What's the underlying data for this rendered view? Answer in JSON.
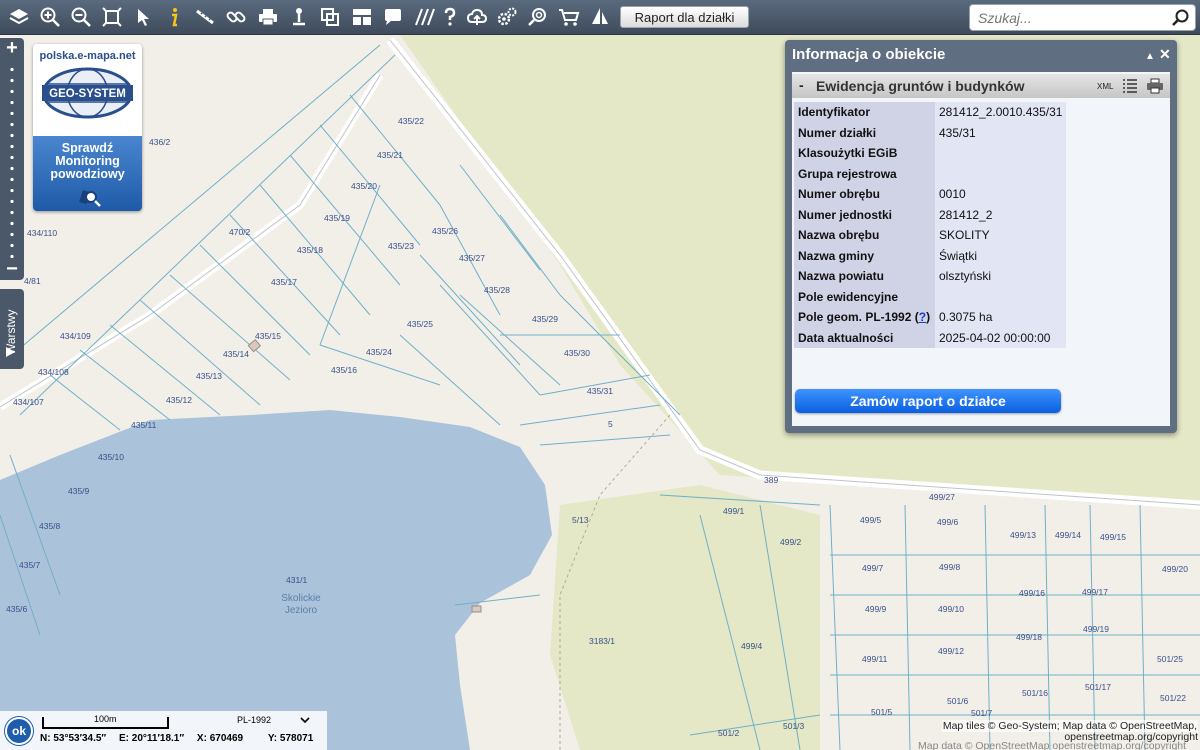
{
  "toolbar": {
    "tools": [
      {
        "name": "layers-icon"
      },
      {
        "name": "zoom-in-icon"
      },
      {
        "name": "zoom-out-icon"
      },
      {
        "name": "full-extent-icon"
      },
      {
        "name": "pointer-icon"
      },
      {
        "name": "info-icon"
      },
      {
        "name": "measure-icon"
      },
      {
        "name": "link-icon"
      },
      {
        "name": "print-icon"
      },
      {
        "name": "marker-icon"
      },
      {
        "name": "copy-icon"
      },
      {
        "name": "layout-icon"
      },
      {
        "name": "comment-icon"
      },
      {
        "name": "hatch-icon"
      },
      {
        "name": "help-icon"
      },
      {
        "name": "cloud-upload-icon"
      },
      {
        "name": "settings-icon"
      },
      {
        "name": "search-zoom-icon"
      },
      {
        "name": "cart-icon"
      },
      {
        "name": "sail-icon"
      }
    ],
    "report_button": "Raport dla działki",
    "search_placeholder": "Szukaj..."
  },
  "zoom": {
    "plus": "+",
    "minus": "−"
  },
  "layers_tab": "Warstwy",
  "banner": {
    "url": "polska.e-mapa.net",
    "logo": "GEO-SYSTEM",
    "line1": "Sprawdź",
    "line2": "Monitoring",
    "line3": "powodziowy"
  },
  "info_panel": {
    "title": "Informacja o obiekcie",
    "collapse": "▲",
    "close": "✕",
    "section_toggle": "-",
    "section_title": "Ewidencja gruntów i budynków",
    "xml_label": "XML",
    "rows": [
      {
        "label": "Identyfikator",
        "value": "281412_2.0010.435/31"
      },
      {
        "label": "Numer działki",
        "value": "435/31"
      },
      {
        "label": "Klasoużytki EGiB",
        "value": ""
      },
      {
        "label": "Grupa rejestrowa",
        "value": ""
      },
      {
        "label": "Numer obrębu",
        "value": "0010"
      },
      {
        "label": "Numer jednostki",
        "value": "281412_2"
      },
      {
        "label": "Nazwa obrębu",
        "value": "SKOLITY"
      },
      {
        "label": "Nazwa gminy",
        "value": "Świątki"
      },
      {
        "label": "Nazwa powiatu",
        "value": "olsztyński"
      },
      {
        "label": "Pole ewidencyjne",
        "value": ""
      },
      {
        "label": "Pole geom. PL-1992",
        "label_link": "?",
        "value": "0.3075 ha"
      },
      {
        "label": "Data aktualności",
        "value": "2025-04-02 00:00:00"
      }
    ],
    "order_button": "Zamów raport o działce"
  },
  "map": {
    "lake_name_1": "Skolickie",
    "lake_name_2": "Jezioro",
    "parcels": [
      {
        "id": "435/22"
      },
      {
        "id": "435/21"
      },
      {
        "id": "435/20"
      },
      {
        "id": "435/19"
      },
      {
        "id": "435/18"
      },
      {
        "id": "435/17"
      },
      {
        "id": "435/15"
      },
      {
        "id": "435/14"
      },
      {
        "id": "435/13"
      },
      {
        "id": "435/12"
      },
      {
        "id": "435/11"
      },
      {
        "id": "435/10"
      },
      {
        "id": "435/9"
      },
      {
        "id": "435/8"
      },
      {
        "id": "435/7"
      },
      {
        "id": "435/6"
      },
      {
        "id": "435/23"
      },
      {
        "id": "435/26"
      },
      {
        "id": "435/27"
      },
      {
        "id": "435/28"
      },
      {
        "id": "435/25"
      },
      {
        "id": "435/24"
      },
      {
        "id": "435/16"
      },
      {
        "id": "435/29"
      },
      {
        "id": "435/30"
      },
      {
        "id": "435/31"
      },
      {
        "id": "5"
      },
      {
        "id": "5/13"
      },
      {
        "id": "436/2"
      },
      {
        "id": "470/2"
      },
      {
        "id": "434/110"
      },
      {
        "id": "434/109"
      },
      {
        "id": "434/108"
      },
      {
        "id": "434/107"
      },
      {
        "id": "4/81"
      },
      {
        "id": "431/1"
      },
      {
        "id": "3183/1"
      },
      {
        "id": "389"
      },
      {
        "id": "499/27"
      },
      {
        "id": "499/1"
      },
      {
        "id": "499/2"
      },
      {
        "id": "499/4"
      },
      {
        "id": "499/5"
      },
      {
        "id": "499/6"
      },
      {
        "id": "499/7"
      },
      {
        "id": "499/8"
      },
      {
        "id": "499/9"
      },
      {
        "id": "499/10"
      },
      {
        "id": "499/11"
      },
      {
        "id": "499/12"
      },
      {
        "id": "499/13"
      },
      {
        "id": "499/14"
      },
      {
        "id": "499/15"
      },
      {
        "id": "499/16"
      },
      {
        "id": "499/17"
      },
      {
        "id": "499/18"
      },
      {
        "id": "499/19"
      },
      {
        "id": "499/20"
      },
      {
        "id": "501/25"
      },
      {
        "id": "501/16"
      },
      {
        "id": "501/17"
      },
      {
        "id": "501/6"
      },
      {
        "id": "501/5"
      },
      {
        "id": "501/7"
      },
      {
        "id": "501/3"
      },
      {
        "id": "501/2"
      },
      {
        "id": "501/22"
      }
    ]
  },
  "status": {
    "ok": "ok",
    "scale": "100m",
    "crs": "PL-1992",
    "lat": "N: 53°53′34.5″",
    "lon": "E: 20°11′18.1″",
    "x": "X: 670469",
    "y": "Y: 578071"
  },
  "attribution": {
    "line1": "Map tiles © Geo-System; Map data © OpenStreetMap,",
    "line2": "openstreetmap.org/copyright",
    "line3": "Map data © OpenStreetMap openstreetmap.org/copyright"
  },
  "colors": {
    "land": "#f2efe9",
    "forest": "#e5e8c8",
    "water": "#aac3da",
    "parcel": "#6fb0c8",
    "toolbar": "#4a5869",
    "accent": "#1d5da9"
  }
}
